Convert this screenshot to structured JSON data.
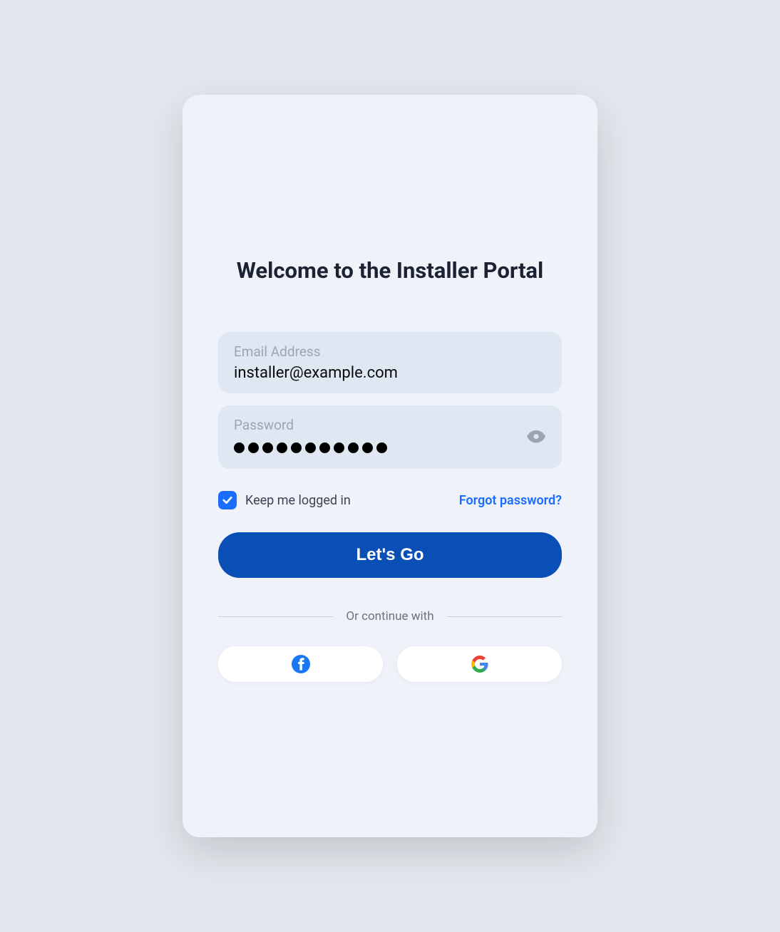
{
  "title": "Welcome to the Installer Portal",
  "email": {
    "label": "Email Address",
    "value": "installer@example.com"
  },
  "password": {
    "label": "Password",
    "value": "●●●●●●●●●●●",
    "dot_count": 11
  },
  "keep_logged_in": {
    "label": "Keep me logged in",
    "checked": true
  },
  "forgot_password": "Forgot password?",
  "submit_label": "Let's Go",
  "divider_text": "Or continue with",
  "social": {
    "facebook": "facebook",
    "google": "google"
  }
}
